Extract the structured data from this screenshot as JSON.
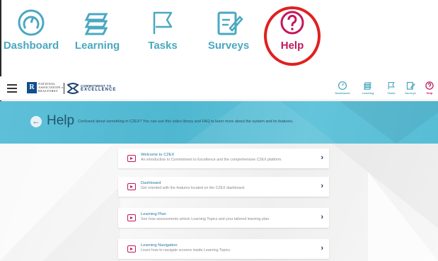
{
  "big_nav": {
    "items": [
      {
        "label": "Dashboard",
        "icon": "dashboard-gauge-icon"
      },
      {
        "label": "Learning",
        "icon": "learning-books-icon"
      },
      {
        "label": "Tasks",
        "icon": "tasks-flag-icon"
      },
      {
        "label": "Surveys",
        "icon": "surveys-edit-icon"
      },
      {
        "label": "Help",
        "icon": "help-question-icon"
      }
    ],
    "highlight": "Help",
    "accent_color": "#4aa8c0",
    "help_color": "#c2185b",
    "ring_color": "#e02020"
  },
  "header": {
    "logo_letter": "R",
    "logo_text_lines": [
      "NATIONAL",
      "ASSOCIATION of",
      "REALTORS®"
    ],
    "logo2_text_lines": [
      "COMMITMENT TO",
      "EXCELLENCE"
    ],
    "nav": [
      {
        "label": "Dashboard"
      },
      {
        "label": "Learning"
      },
      {
        "label": "Tasks"
      },
      {
        "label": "Surveys"
      },
      {
        "label": "Help"
      }
    ]
  },
  "banner": {
    "title": "Help",
    "description": "Confused about something in C2EX? You can use this video library and FAQ to learn more about the system and its features.",
    "back_glyph": "←"
  },
  "videos": [
    {
      "title": "Welcome to C2EX",
      "description": "An introduction to Commitment to Excellence and the comprehensive C2EX platform."
    },
    {
      "title": "Dashboard",
      "description": "Get oriented with the features located on the C2EX dashboard."
    },
    {
      "title": "Learning Plan",
      "description": "See how assessments unlock Learning Topics and your tailored learning plan."
    },
    {
      "title": "Learning Navigation",
      "description": "Learn how to navigate screens inside Learning Topics."
    }
  ],
  "chevron": "›"
}
